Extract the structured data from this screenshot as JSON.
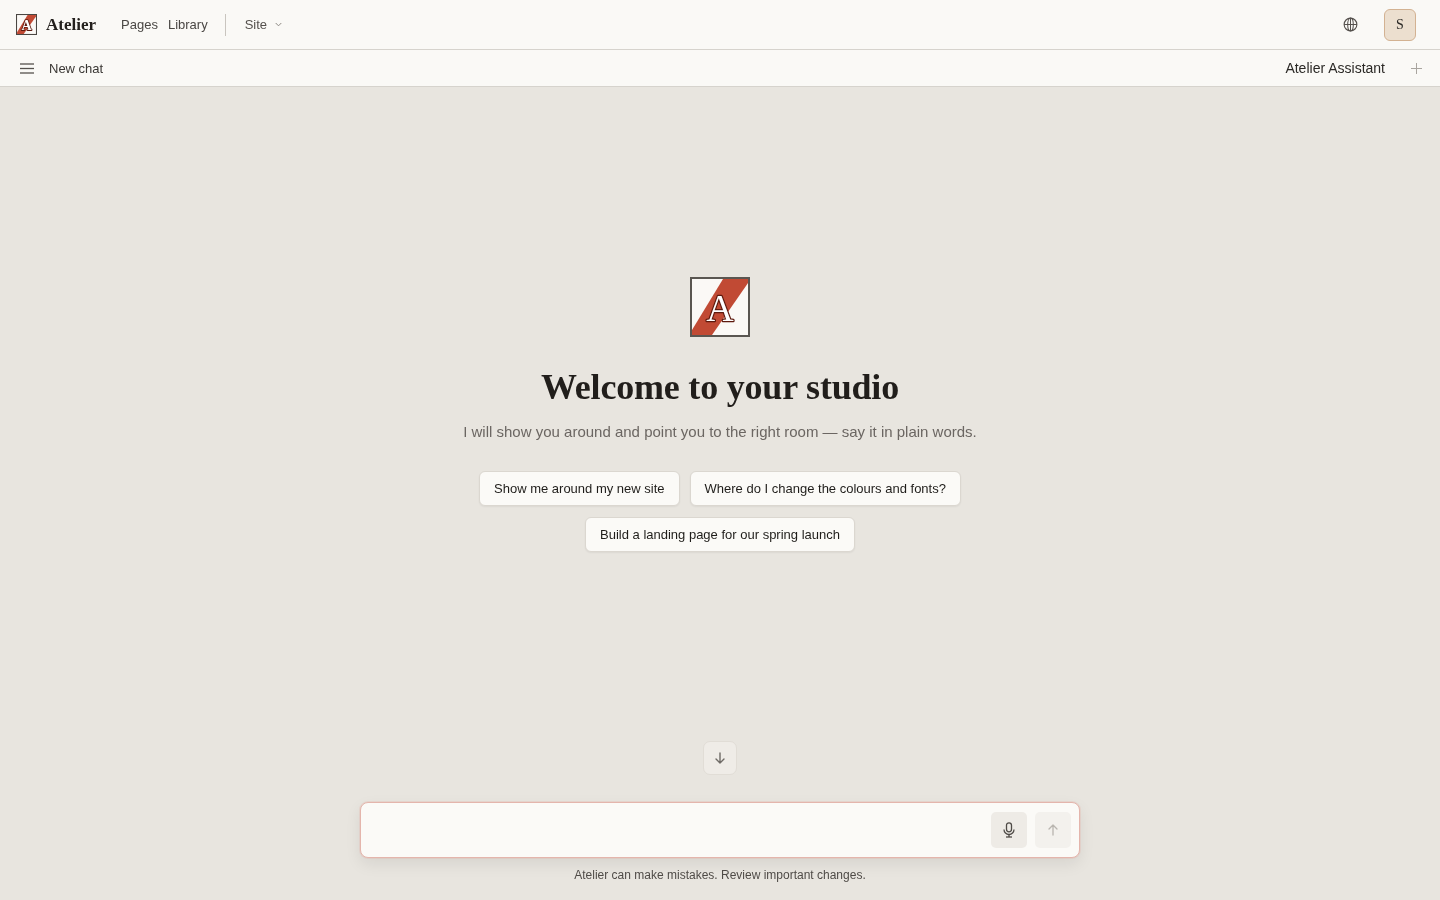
{
  "top_bar": {
    "logo_mark": "A",
    "brand": "Atelier",
    "nav": [
      "Pages",
      "Library"
    ],
    "site_menu": "Site",
    "avatar_initial": "S"
  },
  "chat_bar": {
    "title": "New chat",
    "assistant": "Atelier Assistant"
  },
  "welcome": {
    "logo_mark": "A",
    "title": "Welcome to your studio",
    "subtitle": "I will show you around and point you to the right room — say it in plain words.",
    "suggestions": [
      "Show me around my new site",
      "Where do I change the colours and fonts?",
      "Build a landing page for our spring launch"
    ]
  },
  "composer": {
    "send_disabled": true
  },
  "disclaimer": "Atelier can make mistakes. Review important changes."
}
